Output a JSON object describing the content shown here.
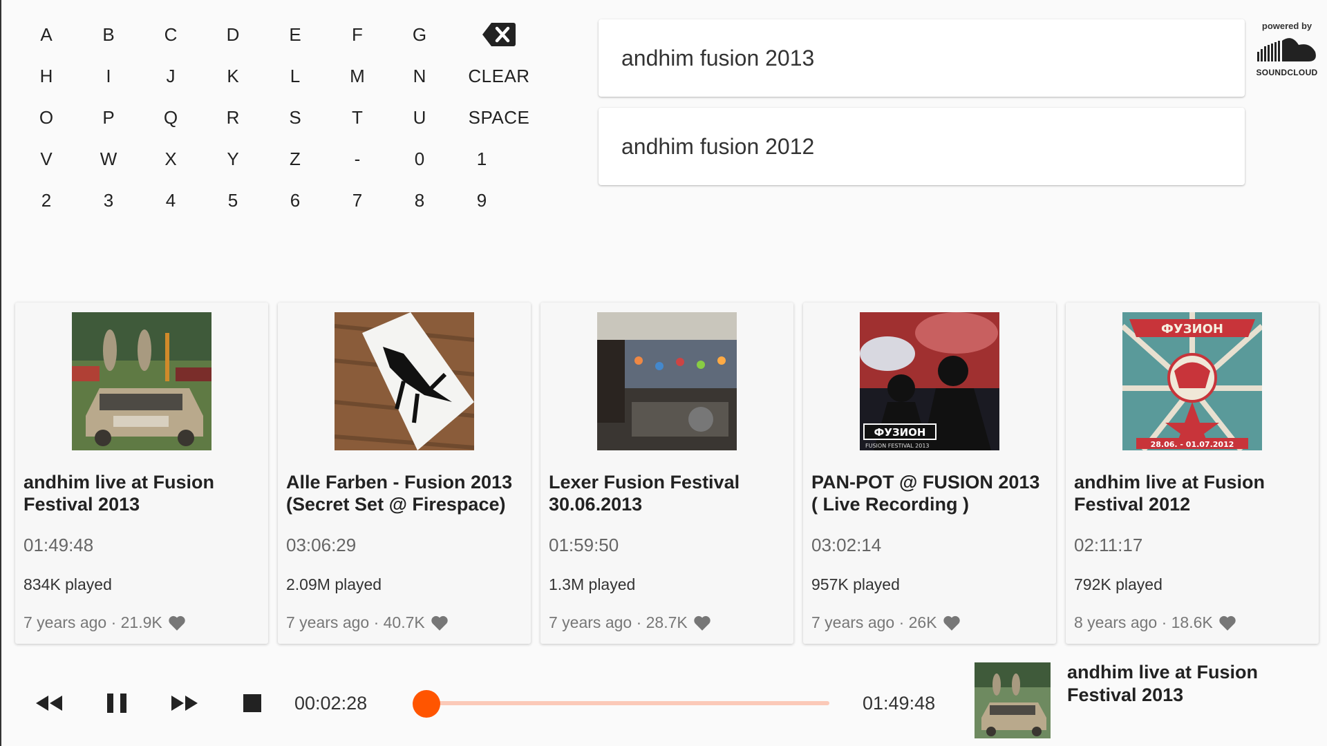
{
  "keyboard": {
    "rows": [
      [
        "A",
        "B",
        "C",
        "D",
        "E",
        "F",
        "G"
      ],
      [
        "H",
        "I",
        "J",
        "K",
        "L",
        "M",
        "N"
      ],
      [
        "O",
        "P",
        "Q",
        "R",
        "S",
        "T",
        "U"
      ],
      [
        "V",
        "W",
        "X",
        "Y",
        "Z",
        "-",
        "0"
      ],
      [
        "2",
        "3",
        "4",
        "5",
        "6",
        "7",
        "8"
      ]
    ],
    "extra": [
      "",
      "CLEAR",
      "SPACE",
      "1",
      "9"
    ],
    "backspace_icon": "backspace-icon"
  },
  "suggestions": [
    "andhim fusion 2013",
    "andhim fusion 2012"
  ],
  "powered_by": {
    "label": "powered by",
    "brand": "SOUNDCLOUD",
    "icon": "soundcloud-logo"
  },
  "results": [
    {
      "title": "andhim live at Fusion Festival 2013",
      "duration": "01:49:48",
      "plays": "834K played",
      "meta": "7 years ago · 21.9K",
      "art": "car-art"
    },
    {
      "title": "Alle Farben - Fusion 2013 (Secret Set @ Firespace)",
      "duration": "03:06:29",
      "plays": "2.09M played",
      "meta": "7 years ago · 40.7K",
      "art": "sticker-art"
    },
    {
      "title": "Lexer Fusion Festival 30.06.2013",
      "duration": "01:59:50",
      "plays": "1.3M played",
      "meta": "7 years ago · 28.7K",
      "art": "crowd-art"
    },
    {
      "title": "PAN-POT @ FUSION 2013 ( Live Recording )",
      "duration": "03:02:14",
      "plays": "957K played",
      "meta": "7 years ago · 26K",
      "art": "stage-art"
    },
    {
      "title": "andhim live at Fusion Festival 2012",
      "duration": "02:11:17",
      "plays": "792K played",
      "meta": "8 years ago · 18.6K",
      "art": "poster-art"
    }
  ],
  "player": {
    "elapsed": "00:02:28",
    "total": "01:49:48",
    "progress_fraction": 0.022,
    "now_playing": "andhim live at Fusion Festival 2013",
    "accent": "#ff5500",
    "track_color": "#fbc9b8",
    "poster_text": "ФУЗИОН",
    "poster_dates": "28.06. - 01.07.2012",
    "stage_label": "ФУЗИОН",
    "stage_sublabel": "FUSION FESTIVAL 2013"
  }
}
